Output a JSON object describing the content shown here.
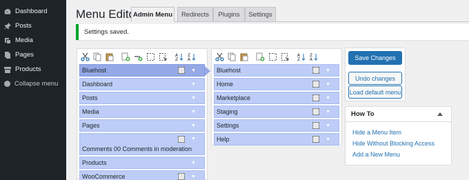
{
  "sidebar": {
    "items": [
      {
        "label": "Dashboard",
        "icon": "dashboard-icon"
      },
      {
        "label": "Posts",
        "icon": "pin-icon"
      },
      {
        "label": "Media",
        "icon": "media-icon"
      },
      {
        "label": "Pages",
        "icon": "pages-icon"
      },
      {
        "label": "Products",
        "icon": "archive-icon"
      },
      {
        "label": "Collapse menu",
        "icon": "collapse-icon"
      }
    ]
  },
  "header": {
    "title": "Menu Editor",
    "tabs": [
      {
        "label": "Admin Menu",
        "active": true
      },
      {
        "label": "Redirects"
      },
      {
        "label": "Plugins"
      },
      {
        "label": "Settings"
      }
    ]
  },
  "notice": {
    "text": "Settings saved.",
    "color": "#00a32a"
  },
  "toolbar_icons": [
    "cut-icon",
    "copy-icon",
    "paste-icon",
    "new-menu-icon",
    "new-separator-icon",
    "dashed-box-icon",
    "export-icon",
    "sort-ascending-icon",
    "sort-descending-icon"
  ],
  "left_menu": {
    "items": [
      {
        "label": "Bluehost",
        "selected": true
      },
      {
        "label": "Dashboard"
      },
      {
        "label": "Posts"
      },
      {
        "label": "Media"
      },
      {
        "label": "Pages"
      },
      {
        "label": "Comments 00 Comments in moderation",
        "tall": true
      },
      {
        "label": "Products"
      },
      {
        "label": "WooCommerce"
      }
    ]
  },
  "right_menu": {
    "items": [
      {
        "label": "Bluehost"
      },
      {
        "label": "Home"
      },
      {
        "label": "Marketplace"
      },
      {
        "label": "Staging"
      },
      {
        "label": "Settings"
      },
      {
        "label": "Help"
      }
    ]
  },
  "actions": {
    "save_label": "Save Changes",
    "undo_label": "Undo changes",
    "load_default_label": "Load default menu"
  },
  "howto": {
    "title": "How To",
    "links": [
      "Hide a Menu Item",
      "Hide Without Blocking Access",
      "Add a New Menu"
    ]
  },
  "colors": {
    "sidebar_bg": "#1d2327",
    "accent": "#2271b1",
    "menu_item_bg": "#bdcdf7",
    "menu_item_selected_bg": "#95a9e6"
  }
}
